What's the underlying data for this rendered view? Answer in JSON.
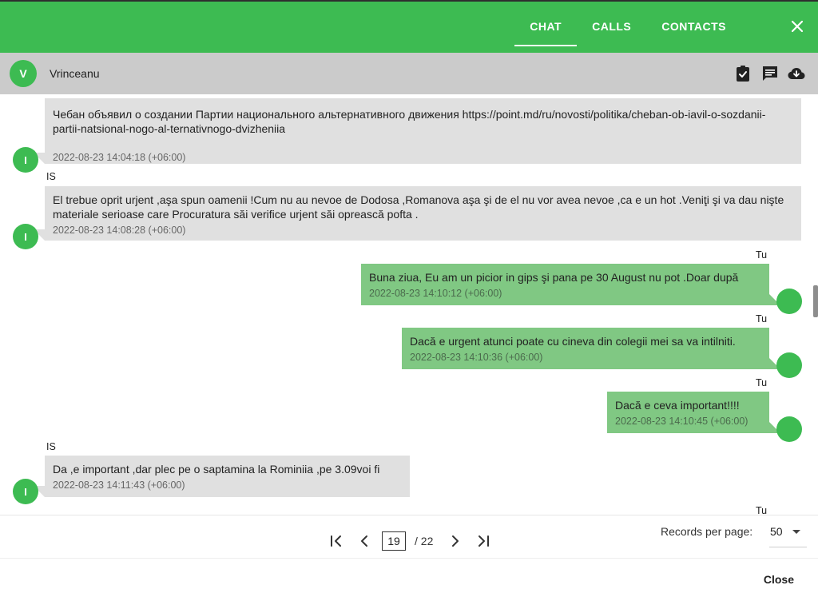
{
  "header": {
    "tabs": [
      {
        "label": "CHAT"
      },
      {
        "label": "CALLS"
      },
      {
        "label": "CONTACTS"
      }
    ]
  },
  "contact": {
    "initial": "V",
    "name": "Vrinceanu"
  },
  "messages": [
    {
      "direction": "in",
      "sender": "",
      "avatar": "I",
      "text": "Чебан объявил о создании Партии национального альтернативного движения https://point.md/ru/novosti/politika/cheban-ob-iavil-o-sozdanii-partii-natsional-nogo-al-ternativnogo-dvizheniia",
      "time": "2022-08-23 14:04:18 (+06:00)"
    },
    {
      "direction": "in",
      "sender": "IS",
      "avatar": "I",
      "text": "El trebue oprit urjent ,aşa spun oamenii !Cum nu au nevoe de Dodosa ,Romanova aşa şi de el nu vor avea nevoe ,ca e un hot .Veniţi şi va dau nişte materiale serioase care Procuratura săi verifice urjent săi oprească pofta .",
      "time": "2022-08-23 14:08:28 (+06:00)"
    },
    {
      "direction": "out",
      "sender": "Tu",
      "avatar": "",
      "text": "Buna ziua, Eu am un picior in gips şi pana pe 30 August nu pot .Doar după",
      "time": "2022-08-23 14:10:12 (+06:00)"
    },
    {
      "direction": "out",
      "sender": "Tu",
      "avatar": "",
      "text": "Dacă e urgent atunci poate cu cineva din colegii mei sa va intilniti.",
      "time": "2022-08-23 14:10:36 (+06:00)"
    },
    {
      "direction": "out",
      "sender": "Tu",
      "avatar": "",
      "text": "Dacă e ceva important!!!!",
      "time": "2022-08-23 14:10:45 (+06:00)"
    },
    {
      "direction": "in",
      "sender": "IS",
      "avatar": "I",
      "text": "Da ,e important ,dar plec pe o saptamina la Rominiia ,pe 3.09voi fi",
      "time": "2022-08-23 14:11:43 (+06:00)"
    },
    {
      "direction": "out",
      "sender": "Tu",
      "avatar": "",
      "text": "",
      "time": ""
    }
  ],
  "pager": {
    "current_page": "19",
    "total": "/ 22",
    "records_label": "Records per page:",
    "records_value": "50"
  },
  "footer": {
    "close_label": "Close"
  },
  "icons": {
    "close": "close-icon",
    "tasks": "clipboard-check-icon",
    "notes": "message-icon",
    "download": "cloud-download-icon"
  },
  "colors": {
    "primary": "#3dbb52",
    "incoming_bubble": "#e0e0e0",
    "outgoing_bubble": "#80c883",
    "contact_bar": "#cbcbcb"
  }
}
